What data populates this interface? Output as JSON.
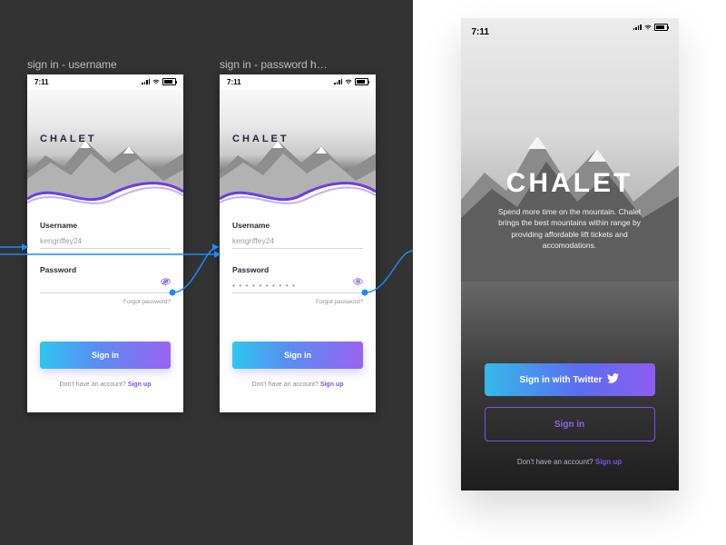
{
  "status_time": "7:11",
  "left_panel": {
    "artboards": [
      {
        "label": "sign in - username"
      },
      {
        "label": "sign in - password h…"
      }
    ],
    "brand": "CHALET",
    "form": {
      "username_label": "Username",
      "username_value": "kengriffey24",
      "password_label": "Password",
      "password_mask": "• • • • • • • • • •",
      "forgot": "Forgot password?"
    },
    "signin": "Sign in",
    "signup_prompt": "Don't have an account?",
    "signup_link": "Sign up"
  },
  "right_panel": {
    "title": "CHALET",
    "tagline": "Spend more time on the mountain. Chalet brings the best mountains within range by providing affordable lift tickets and accomodations.",
    "twitter_btn": "Sign in with Twitter",
    "signin_btn": "Sign in",
    "signup_prompt": "Don't have an account?",
    "signup_link": "Sign up"
  },
  "colors": {
    "accent_purple": "#7a51e8",
    "grad_start": "#2ec6f0",
    "grad_end": "#9a63f2"
  }
}
